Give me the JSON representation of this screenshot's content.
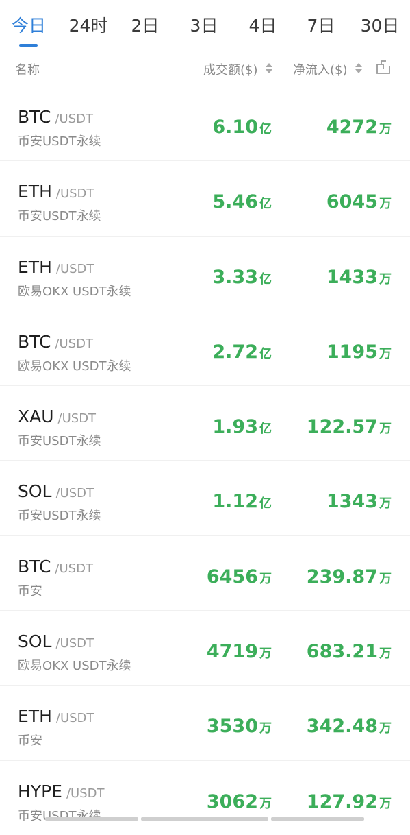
{
  "tabs": [
    {
      "label": "今日",
      "active": true
    },
    {
      "label": "24时",
      "active": false
    },
    {
      "label": "2日",
      "active": false
    },
    {
      "label": "3日",
      "active": false
    },
    {
      "label": "4日",
      "active": false
    },
    {
      "label": "7日",
      "active": false
    },
    {
      "label": "30日",
      "active": false
    }
  ],
  "header": {
    "name": "名称",
    "volume": "成交额($)",
    "netflow": "净流入($)"
  },
  "icons": {
    "sort": "sort-icon",
    "share": "share-icon"
  },
  "colors": {
    "accent": "#2f7fd8",
    "positive": "#3cae5a"
  },
  "rows": [
    {
      "symbol": "BTC",
      "pair": "/USDT",
      "exchange": "币安USDT永续",
      "volume": "6.10",
      "volume_unit": "亿",
      "netflow": "4272",
      "netflow_unit": "万"
    },
    {
      "symbol": "ETH",
      "pair": "/USDT",
      "exchange": "币安USDT永续",
      "volume": "5.46",
      "volume_unit": "亿",
      "netflow": "6045",
      "netflow_unit": "万"
    },
    {
      "symbol": "ETH",
      "pair": "/USDT",
      "exchange": "欧易OKX USDT永续",
      "volume": "3.33",
      "volume_unit": "亿",
      "netflow": "1433",
      "netflow_unit": "万"
    },
    {
      "symbol": "BTC",
      "pair": "/USDT",
      "exchange": "欧易OKX USDT永续",
      "volume": "2.72",
      "volume_unit": "亿",
      "netflow": "1195",
      "netflow_unit": "万"
    },
    {
      "symbol": "XAU",
      "pair": "/USDT",
      "exchange": "币安USDT永续",
      "volume": "1.93",
      "volume_unit": "亿",
      "netflow": "122.57",
      "netflow_unit": "万"
    },
    {
      "symbol": "SOL",
      "pair": "/USDT",
      "exchange": "币安USDT永续",
      "volume": "1.12",
      "volume_unit": "亿",
      "netflow": "1343",
      "netflow_unit": "万"
    },
    {
      "symbol": "BTC",
      "pair": "/USDT",
      "exchange": "币安",
      "volume": "6456",
      "volume_unit": "万",
      "netflow": "239.87",
      "netflow_unit": "万"
    },
    {
      "symbol": "SOL",
      "pair": "/USDT",
      "exchange": "欧易OKX USDT永续",
      "volume": "4719",
      "volume_unit": "万",
      "netflow": "683.21",
      "netflow_unit": "万"
    },
    {
      "symbol": "ETH",
      "pair": "/USDT",
      "exchange": "币安",
      "volume": "3530",
      "volume_unit": "万",
      "netflow": "342.48",
      "netflow_unit": "万"
    },
    {
      "symbol": "HYPE",
      "pair": "/USDT",
      "exchange": "币安USDT永续",
      "volume": "3062",
      "volume_unit": "万",
      "netflow": "127.92",
      "netflow_unit": "万"
    }
  ]
}
